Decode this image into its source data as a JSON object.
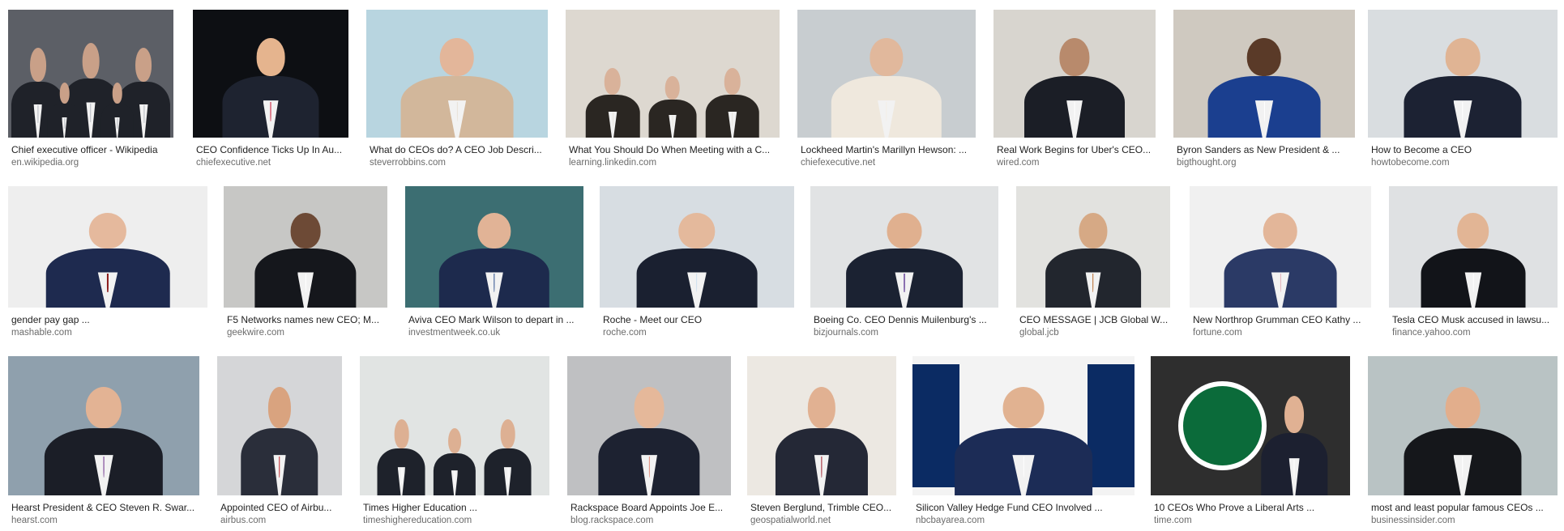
{
  "results": [
    {
      "caption": "Chief executive officer - Wikipedia",
      "source": "en.wikipedia.org",
      "bg": "#5c5f66",
      "suit": "#1f2229",
      "skin": "#c9a088",
      "accent": "#b5b9c0",
      "variant": "group",
      "thumb_icon": "group-photo-icon"
    },
    {
      "caption": "CEO Confidence Ticks Up In Au...",
      "source": "chiefexecutive.net",
      "bg": "#0d0f13",
      "suit": "#1e2330",
      "skin": "#e5b48e",
      "accent": "#c8102e",
      "variant": "person",
      "thumb_icon": "person-photo-icon"
    },
    {
      "caption": "What do CEOs do? A CEO Job Descri...",
      "source": "steverrobbins.com",
      "bg": "#b8d5e0",
      "suit": "#d2b79b",
      "skin": "#e3b69a",
      "accent": "#e9e2d8",
      "variant": "person",
      "thumb_icon": "person-photo-icon"
    },
    {
      "caption": "What You Should Do When Meeting with a C...",
      "source": "learning.linkedin.com",
      "bg": "#ddd8d0",
      "suit": "#2a2622",
      "skin": "#d9b29a",
      "accent": "#e8e4de",
      "variant": "meeting",
      "thumb_icon": "meeting-photo-icon"
    },
    {
      "caption": "Lockheed Martin's Marillyn Hewson: ...",
      "source": "chiefexecutive.net",
      "bg": "#c8cdd0",
      "suit": "#efe8dd",
      "skin": "#e1b89c",
      "accent": "#f4efe6",
      "variant": "person",
      "thumb_icon": "person-photo-icon"
    },
    {
      "caption": "Real Work Begins for Uber's CEO...",
      "source": "wired.com",
      "bg": "#d8d5cf",
      "suit": "#1b1e26",
      "skin": "#b88a6c",
      "accent": "#ffffff",
      "variant": "person",
      "thumb_icon": "person-photo-icon"
    },
    {
      "caption": "Byron Sanders as New President & ...",
      "source": "bigthought.org",
      "bg": "#cfc9c0",
      "suit": "#1b3f8f",
      "skin": "#5a3a28",
      "accent": "#ffffff",
      "variant": "person",
      "thumb_icon": "person-photo-icon"
    },
    {
      "caption": "How to Become a CEO",
      "source": "howtobecome.com",
      "bg": "#d9dde0",
      "suit": "#1c2233",
      "skin": "#e0b494",
      "accent": "#ffffff",
      "variant": "person",
      "thumb_icon": "person-photo-icon"
    },
    {
      "caption": "gender pay gap ...",
      "source": "mashable.com",
      "bg": "#eeeeee",
      "suit": "#1e2a4f",
      "skin": "#e5b99d",
      "accent": "#8b1a1a",
      "variant": "person",
      "thumb_icon": "person-photo-icon"
    },
    {
      "caption": "F5 Networks names new CEO; M...",
      "source": "geekwire.com",
      "bg": "#c7c7c5",
      "suit": "#15171c",
      "skin": "#6d4a36",
      "accent": "#ffffff",
      "variant": "person",
      "thumb_icon": "person-photo-icon"
    },
    {
      "caption": "Aviva CEO Mark Wilson to depart in ...",
      "source": "investmentweek.co.uk",
      "bg": "#3c6e72",
      "suit": "#1d2a4d",
      "skin": "#e1b396",
      "accent": "#2c4f8f",
      "variant": "person",
      "thumb_icon": "person-photo-icon"
    },
    {
      "caption": "Roche - Meet our CEO",
      "source": "roche.com",
      "bg": "#d7dde2",
      "suit": "#1a2030",
      "skin": "#e4b99c",
      "accent": "#cfe0ef",
      "variant": "person",
      "thumb_icon": "person-photo-icon"
    },
    {
      "caption": "Boeing Co. CEO Dennis Muilenburg's ...",
      "source": "bizjournals.com",
      "bg": "#e1e3e4",
      "suit": "#1b2232",
      "skin": "#e0b08f",
      "accent": "#8a6fb0",
      "variant": "person",
      "thumb_icon": "person-photo-icon"
    },
    {
      "caption": "CEO MESSAGE | JCB Global W...",
      "source": "global.jcb",
      "bg": "#e2e2df",
      "suit": "#22262e",
      "skin": "#d6a985",
      "accent": "#b86a2c",
      "variant": "person",
      "thumb_icon": "person-photo-icon"
    },
    {
      "caption": "New Northrop Grumman CEO Kathy ...",
      "source": "fortune.com",
      "bg": "#f0f0f0",
      "suit": "#2b3a66",
      "skin": "#e3b699",
      "accent": "#e3b0b9",
      "variant": "person",
      "thumb_icon": "person-photo-icon"
    },
    {
      "caption": "Tesla CEO Musk accused in lawsu...",
      "source": "finance.yahoo.com",
      "bg": "#dfe1e3",
      "suit": "#121419",
      "skin": "#e2b595",
      "accent": "#ffffff",
      "variant": "person",
      "thumb_icon": "person-photo-icon"
    },
    {
      "caption": "Hearst President & CEO Steven R. Swar...",
      "source": "hearst.com",
      "bg": "#8fa0ad",
      "suit": "#1b1e27",
      "skin": "#e3b394",
      "accent": "#6b2d8a",
      "variant": "person",
      "thumb_icon": "person-photo-icon"
    },
    {
      "caption": "Appointed CEO of Airbu...",
      "source": "airbus.com",
      "bg": "#d5d6d8",
      "suit": "#2a2e3a",
      "skin": "#d9a37f",
      "accent": "#c0252b",
      "variant": "person",
      "thumb_icon": "person-photo-icon"
    },
    {
      "caption": "Times Higher Education ...",
      "source": "timeshighereducation.com",
      "bg": "#e1e4e3",
      "suit": "#1e222b",
      "skin": "#ddb093",
      "accent": "#ffffff",
      "variant": "meeting",
      "thumb_icon": "meeting-photo-icon"
    },
    {
      "caption": "Rackspace Board Appoints Joe E...",
      "source": "blog.rackspace.com",
      "bg": "#bfc0c2",
      "suit": "#1d2231",
      "skin": "#e5b89a",
      "accent": "#e28b7a",
      "variant": "person",
      "thumb_icon": "person-photo-icon"
    },
    {
      "caption": "Steven Berglund, Trimble CEO...",
      "source": "geospatialworld.net",
      "bg": "#ece8e2",
      "suit": "#242836",
      "skin": "#e1b192",
      "accent": "#9e1e2c",
      "variant": "person",
      "thumb_icon": "person-photo-icon"
    },
    {
      "caption": "Silicon Valley Hedge Fund CEO Involved ...",
      "source": "nbcbayarea.com",
      "bg": "#f3f3f3",
      "suit": "#1c2c56",
      "skin": "#e1b291",
      "accent": "#ffffff",
      "variant": "panels",
      "thumb_icon": "person-photo-icon"
    },
    {
      "caption": "10 CEOs Who Prove a Liberal Arts ...",
      "source": "time.com",
      "bg": "#2e2e2e",
      "suit": "#1c2030",
      "skin": "#e0b193",
      "accent": "#ffffff",
      "variant": "logo",
      "thumb_icon": "starbucks-logo-icon"
    },
    {
      "caption": "most and least popular famous CEOs ...",
      "source": "businessinsider.com",
      "bg": "#b9c3c4",
      "suit": "#15171b",
      "skin": "#e2ae8c",
      "accent": "#ffffff",
      "variant": "person",
      "thumb_icon": "person-photo-icon"
    }
  ]
}
